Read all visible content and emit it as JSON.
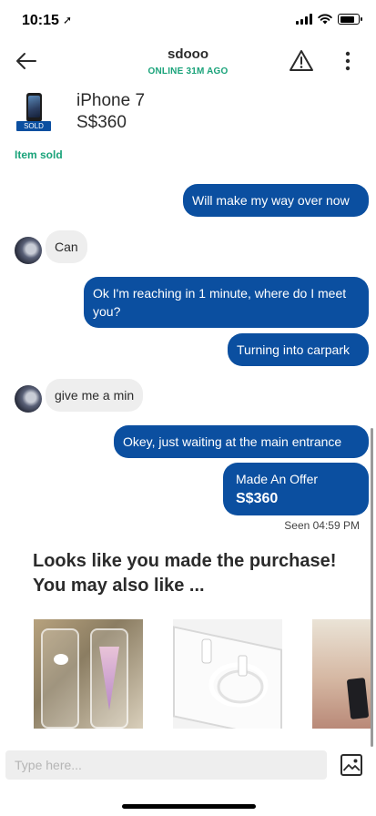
{
  "status_bar": {
    "time": "10:15",
    "battery_level": 0.85,
    "signal_bars": 4
  },
  "header": {
    "name": "sdooo",
    "status": "ONLINE 31M AGO",
    "back_icon": "arrow-left-icon",
    "warning_icon": "warning-triangle-icon",
    "more_icon": "more-vertical-icon"
  },
  "listing": {
    "title": "iPhone 7",
    "price": "S$360",
    "sold_badge": "SOLD",
    "sold_label": "Item sold"
  },
  "messages": [
    {
      "side": "out",
      "text": "Will make my way over now"
    },
    {
      "side": "in",
      "text": "Can"
    },
    {
      "side": "out",
      "text": "Ok I'm reaching in 1 minute, where do I meet you?"
    },
    {
      "side": "out",
      "text": "Turning into carpark"
    },
    {
      "side": "in",
      "text": "give me a min"
    },
    {
      "side": "out",
      "text": "Okey, just waiting at the main entrance"
    }
  ],
  "offer": {
    "title": "Made An Offer",
    "price": "S$360"
  },
  "seen": "Seen 04:59 PM",
  "recommendations": {
    "heading": "Looks like you made the purchase! You may also like ..."
  },
  "input": {
    "placeholder": "Type here...",
    "image_icon": "image-picker-icon"
  },
  "colors": {
    "accent": "#0b4fa0",
    "online_green": "#1aa37a",
    "incoming_bubble": "#eeeeee"
  }
}
